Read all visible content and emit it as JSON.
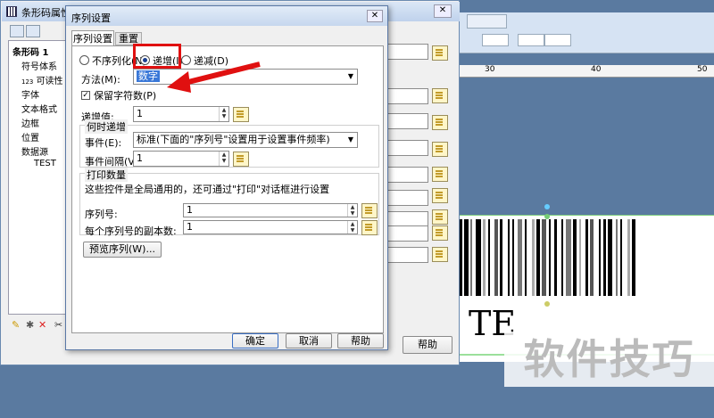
{
  "props_window": {
    "title": "条形码属性",
    "close": "✕",
    "tree": [
      "条形码 1",
      "符号体系",
      "可读性",
      "字体",
      "文本格式",
      "边框",
      "位置",
      "数据源",
      "TEST"
    ],
    "readable_prefix": "123",
    "help_button": "帮助"
  },
  "designer": {
    "ruler_ticks": [
      "30",
      "40",
      "50"
    ],
    "readable_text": "TE"
  },
  "dialog": {
    "title": "序列设置",
    "close": "✕",
    "tabs": [
      "序列设置",
      "重置"
    ],
    "radio_none": "不序列化(N)",
    "radio_inc": "递增(I)",
    "radio_dec": "递减(D)",
    "method_label": "方法(M):",
    "method_value": "数字",
    "keep_chars": "保留字符数(P)",
    "increment_label": "递增值:",
    "increment_value": "1",
    "when_group": "何时递增",
    "event_label": "事件(E):",
    "event_value": "标准(下面的\"序列号\"设置用于设置事件频率)",
    "interval_label": "事件间隔(V):",
    "interval_value": "1",
    "print_group": "打印数量",
    "print_note": "这些控件是全局通用的，还可通过\"打印\"对话框进行设置",
    "serial_label": "序列号:",
    "serial_value": "1",
    "copies_label": "每个序列号的副本数:",
    "copies_value": "1",
    "preview_button": "预览序列(W)...",
    "ok": "确定",
    "cancel": "取消",
    "help": "帮助"
  },
  "watermark": "软件技巧",
  "colors": {
    "annotation_red": "#e01010",
    "title_blue": "#c6d7ee"
  }
}
